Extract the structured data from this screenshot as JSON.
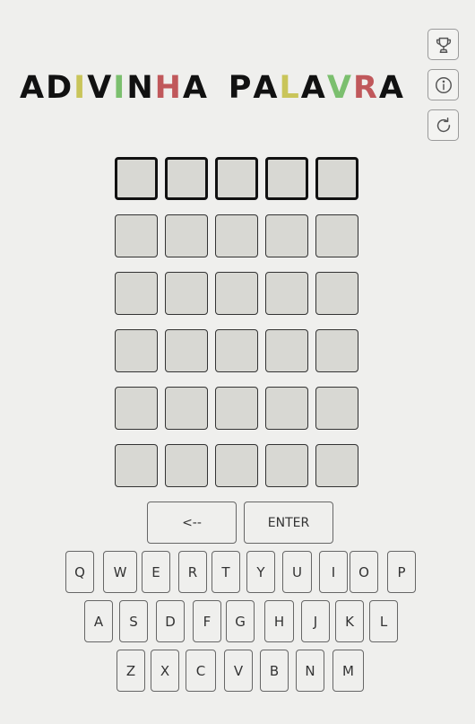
{
  "title": {
    "letters": [
      {
        "ch": "A",
        "color": "#111111"
      },
      {
        "ch": "D",
        "color": "#111111"
      },
      {
        "ch": "I",
        "color": "#c9c55a"
      },
      {
        "ch": "V",
        "color": "#111111"
      },
      {
        "ch": "I",
        "color": "#7bbf6e"
      },
      {
        "ch": "N",
        "color": "#111111"
      },
      {
        "ch": "H",
        "color": "#c0585b"
      },
      {
        "ch": "A",
        "color": "#111111"
      },
      {
        "ch": " ",
        "color": "#111111"
      },
      {
        "ch": "P",
        "color": "#111111"
      },
      {
        "ch": "A",
        "color": "#111111"
      },
      {
        "ch": "L",
        "color": "#c9c55a"
      },
      {
        "ch": "A",
        "color": "#111111"
      },
      {
        "ch": "V",
        "color": "#7bbf6e"
      },
      {
        "ch": "R",
        "color": "#c0585b"
      },
      {
        "ch": "A",
        "color": "#111111"
      }
    ]
  },
  "side_buttons": [
    {
      "name": "trophy-button",
      "icon": "trophy-icon"
    },
    {
      "name": "info-button",
      "icon": "info-icon"
    },
    {
      "name": "restart-button",
      "icon": "restart-icon"
    }
  ],
  "board": {
    "rows": 6,
    "cols": 5,
    "active_row": 0
  },
  "keyboard": {
    "actions": [
      "<--",
      "ENTER"
    ],
    "row1": [
      "Q",
      "W",
      "E",
      "R",
      "T",
      "Y",
      "U",
      "I",
      "O",
      "P"
    ],
    "row2": [
      "A",
      "S",
      "D",
      "F",
      "G",
      "H",
      "J",
      "K",
      "L"
    ],
    "row3": [
      "Z",
      "X",
      "C",
      "V",
      "B",
      "N",
      "M"
    ]
  }
}
